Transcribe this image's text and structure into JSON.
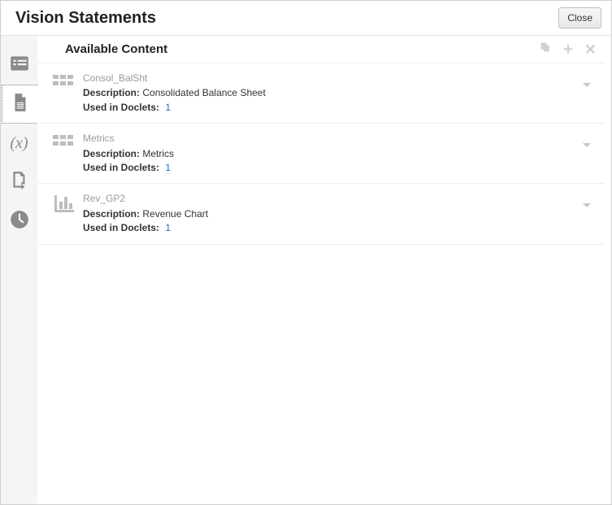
{
  "title": "Vision Statements",
  "close_label": "Close",
  "section_title": "Available Content",
  "labels": {
    "description": "Description:",
    "used_in": "Used in Doclets:"
  },
  "items": [
    {
      "name": "Consol_BalSht",
      "description": "Consolidated Balance Sheet",
      "used_in_doclets": "1",
      "icon": "grid"
    },
    {
      "name": "Metrics",
      "description": "Metrics",
      "used_in_doclets": "1",
      "icon": "grid"
    },
    {
      "name": "Rev_GP2",
      "description": "Revenue Chart",
      "used_in_doclets": "1",
      "icon": "chart"
    }
  ]
}
